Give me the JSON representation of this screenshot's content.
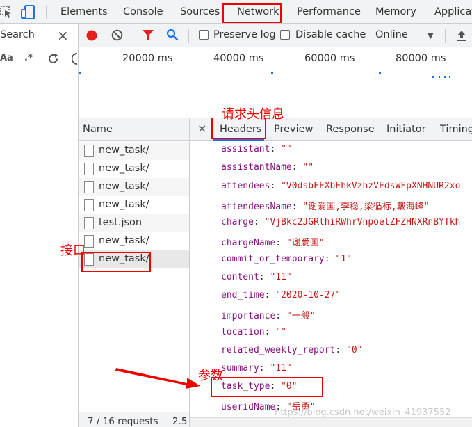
{
  "tabbar": {
    "tabs": [
      "Elements",
      "Console",
      "Sources",
      "Network",
      "Performance",
      "Memory",
      "Applicat"
    ],
    "active_tab": "Network"
  },
  "search": {
    "label": "Search",
    "close": "×",
    "option_case": "Aa",
    "option_regex": ".*"
  },
  "toolbar": {
    "preserve_log": "Preserve log",
    "disable_cache": "Disable cache",
    "throttle": "Online",
    "throttle_arrow": "▼"
  },
  "overview": {
    "ticks": [
      "20000 ms",
      "40000 ms",
      "60000 ms",
      "80000 ms"
    ]
  },
  "request_list": {
    "column_name": "Name",
    "items": [
      "new_task/",
      "new_task/",
      "new_task/",
      "new_task/",
      "test.json",
      "new_task/",
      "new_task/"
    ],
    "selected_index": 6,
    "status_requests": "7 / 16 requests",
    "status_size": "2.5"
  },
  "details": {
    "close": "×",
    "tabs": [
      "Headers",
      "Preview",
      "Response",
      "Initiator",
      "Timing"
    ],
    "active_tab": "Headers",
    "params": [
      {
        "key": "assistant",
        "value": "\"\""
      },
      {
        "key": "assistantName",
        "value": "\"\""
      },
      {
        "key": "attendees",
        "value": "\"V0dsbFFXbEhkVzhzVEdsWFpXNHNUR2xo"
      },
      {
        "key": "attendeesName",
        "value": "\"谢爱国,李稳,梁循标,戴海峰\""
      },
      {
        "key": "charge",
        "value": "\"VjBkc2JGRlhiRWhrVnpoelZFZHNXRnBYTkh"
      },
      {
        "key": "chargeName",
        "value": "\"谢爱国\""
      },
      {
        "key": "commit_or_temporary",
        "value": "\"1\""
      },
      {
        "key": "content",
        "value": "\"11\""
      },
      {
        "key": "end_time",
        "value": "\"2020-10-27\""
      },
      {
        "key": "importance",
        "value": "\"一般\""
      },
      {
        "key": "location",
        "value": "\"\""
      },
      {
        "key": "related_weekly_report",
        "value": "\"0\""
      },
      {
        "key": "summary",
        "value": "\"11\""
      },
      {
        "key": "task_type",
        "value": "\"0\""
      },
      {
        "key": "useridName",
        "value": "\"岳勇\""
      }
    ]
  },
  "annotations": {
    "headers_label": "请求头信息",
    "interface_label": "接口",
    "params_label": "参数",
    "color": "#e00000"
  },
  "watermark": "https://blog.csdn.net/weixin_41937552"
}
